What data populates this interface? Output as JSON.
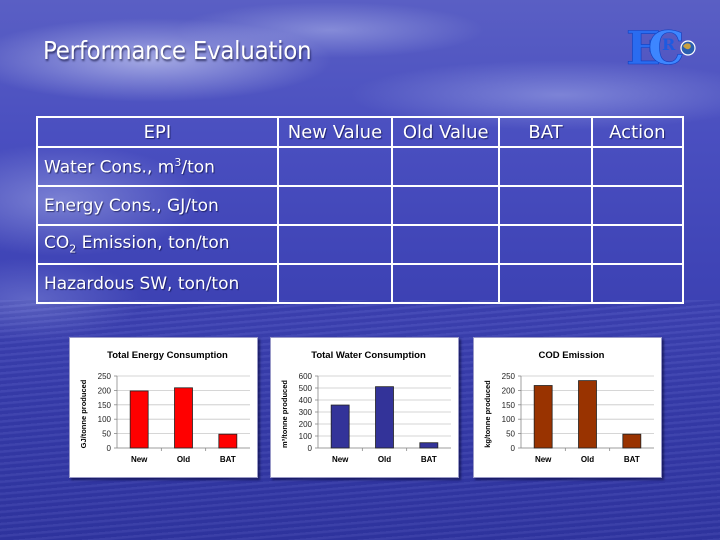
{
  "slide": {
    "title": "Performance Evaluation",
    "logo": {
      "icon": "erc-logo-icon",
      "letters": [
        "E",
        "R",
        "C"
      ]
    }
  },
  "table": {
    "headers": [
      "EPI",
      "New Value",
      "Old Value",
      "BAT",
      "Action"
    ],
    "rows": [
      {
        "label": "Water Cons., m",
        "sup": "3",
        "suffix": "/ton",
        "cells": [
          "",
          "",
          "",
          ""
        ]
      },
      {
        "label": "Energy Cons., GJ/ton",
        "cells": [
          "",
          "",
          "",
          ""
        ]
      },
      {
        "label": "CO",
        "sub": "2",
        "suffix": " Emission, ton/ton",
        "cells": [
          "",
          "",
          "",
          ""
        ]
      },
      {
        "label": "Hazardous SW, ton/ton",
        "cells": [
          "",
          "",
          "",
          ""
        ]
      }
    ]
  },
  "chart_data": [
    {
      "type": "bar",
      "title": "Total Energy Consumption",
      "categories": [
        "New",
        "Old",
        "BAT"
      ],
      "values": [
        198,
        209,
        48
      ],
      "xlabel": "",
      "ylabel": "GJ/tonne produced",
      "ylim": [
        0,
        250
      ],
      "yticks": [
        0,
        50,
        100,
        150,
        200,
        250
      ],
      "grid": true,
      "color": "#ff0000"
    },
    {
      "type": "bar",
      "title": "Total Water Consumption",
      "categories": [
        "New",
        "Old",
        "BAT"
      ],
      "values": [
        358,
        511,
        44
      ],
      "xlabel": "",
      "ylabel": "m³/tonne produced",
      "ylim": [
        0,
        600
      ],
      "yticks": [
        0,
        100,
        200,
        300,
        400,
        500,
        600
      ],
      "grid": true,
      "color": "#333399"
    },
    {
      "type": "bar",
      "title": "COD Emission",
      "categories": [
        "New",
        "Old",
        "BAT"
      ],
      "values": [
        217,
        234,
        48
      ],
      "xlabel": "",
      "ylabel": "kg/tonne produced",
      "ylim": [
        0,
        250
      ],
      "yticks": [
        0,
        50,
        100,
        150,
        200,
        250
      ],
      "grid": true,
      "color": "#993300"
    }
  ]
}
